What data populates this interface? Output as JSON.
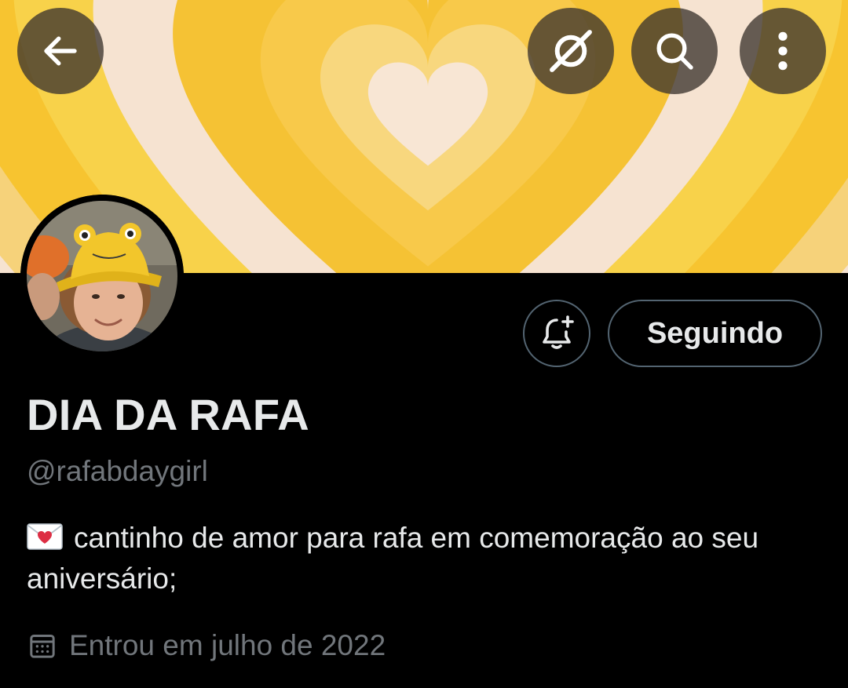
{
  "profile": {
    "display_name": "DIA DA RAFA",
    "handle": "@rafabdaygirl",
    "bio_emoji": "love-letter-icon",
    "bio_text": "cantinho de amor para rafa em comemoração ao seu aniversário;",
    "joined": "Entrou em julho de 2022"
  },
  "actions": {
    "follow_label": "Seguindo",
    "notify_icon": "bell-plus-icon"
  },
  "header_buttons": {
    "back_icon": "arrow-left-icon",
    "grok_icon": "grok-icon",
    "search_icon": "search-icon",
    "more_icon": "more-vertical-icon"
  },
  "colors": {
    "background": "#000000",
    "text_primary": "#e7e9ea",
    "text_secondary": "#71767b",
    "button_border": "#536471",
    "banner_yellow": "#f7c430",
    "banner_cream": "#f6e3d1"
  }
}
